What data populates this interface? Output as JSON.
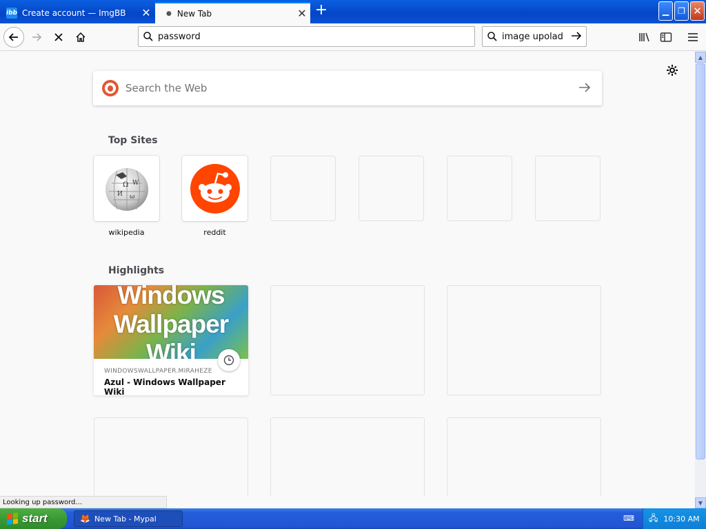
{
  "browser": {
    "tabs": [
      {
        "label": "Create account — ImgBB",
        "icon": "imgbb-favicon",
        "icon_text": "ibb"
      },
      {
        "label": "New Tab",
        "icon": "loading-dot",
        "active": true
      }
    ],
    "url": "password",
    "search_value": "image upolad",
    "status_text": "Looking up password..."
  },
  "newtab": {
    "search_placeholder": "Search the Web",
    "top_sites_title": "Top Sites",
    "top_sites": [
      {
        "label": "wikipedia",
        "icon": "wikipedia-globe-icon"
      },
      {
        "label": "reddit",
        "icon": "reddit-alien-icon"
      },
      {
        "label": ""
      },
      {
        "label": ""
      },
      {
        "label": ""
      },
      {
        "label": ""
      }
    ],
    "highlights_title": "Highlights",
    "highlights": [
      {
        "thumb_lines": [
          "Windows",
          "Wallpaper",
          "Wiki"
        ],
        "host": "WINDOWSWALLPAPER.MIRAHEZE",
        "title": "Azul - Windows Wallpaper Wiki"
      }
    ]
  },
  "taskbar": {
    "start_label": "start",
    "task_label": "New Tab - Mypal",
    "clock": "10:30 AM"
  },
  "colors": {
    "accent": "#0a84ff",
    "reddit": "#ff4500",
    "ddg": "#de5833",
    "xp_taskbar": "#245edb",
    "xp_start": "#3a9a34"
  }
}
